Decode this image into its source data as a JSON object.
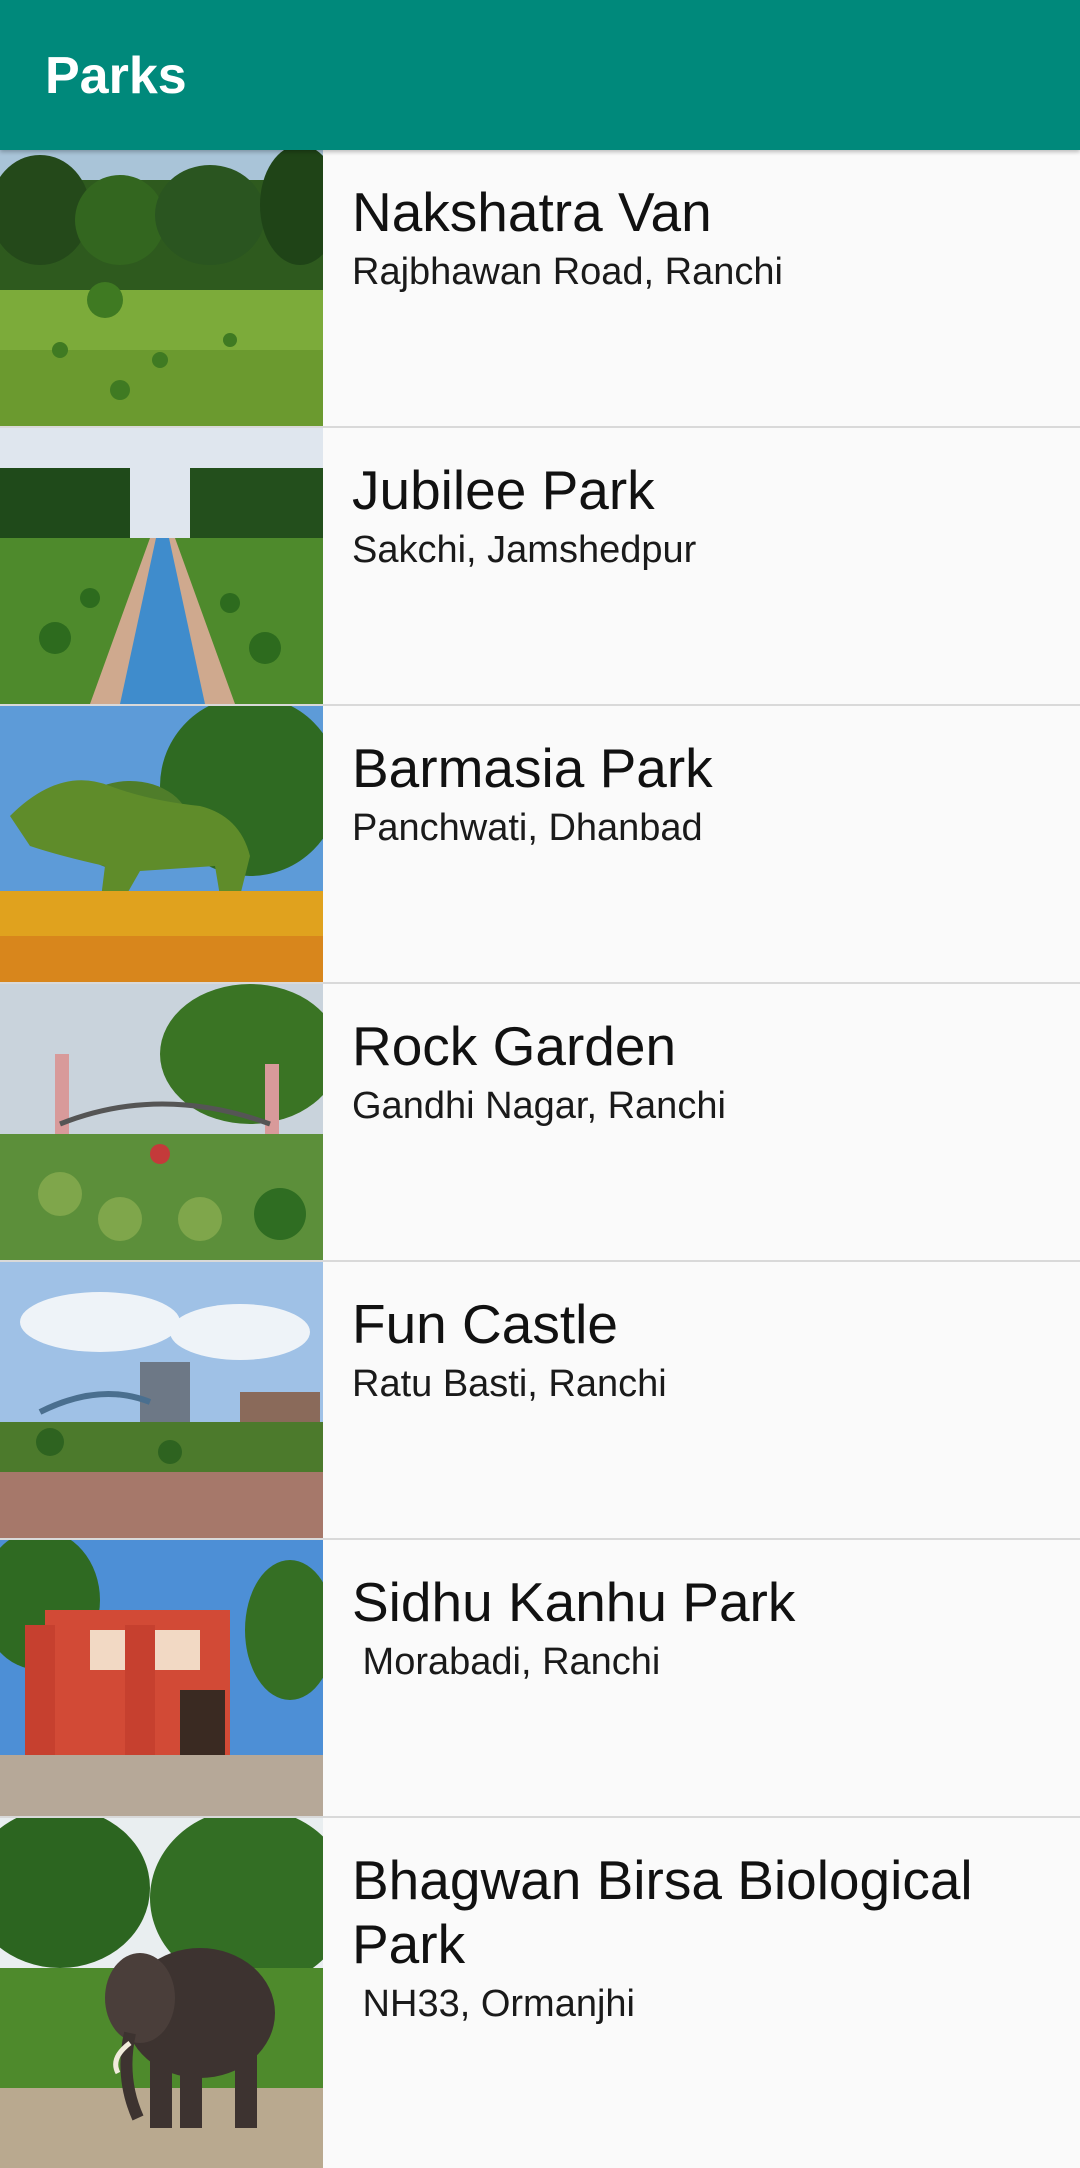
{
  "app_bar": {
    "title": "Parks",
    "color": "#00897b"
  },
  "parks": [
    {
      "name": "Nakshatra Van",
      "location": "Rajbhawan Road, Ranchi"
    },
    {
      "name": "Jubilee Park",
      "location": "Sakchi, Jamshedpur"
    },
    {
      "name": "Barmasia Park",
      "location": "Panchwati, Dhanbad"
    },
    {
      "name": "Rock Garden",
      "location": "Gandhi Nagar, Ranchi"
    },
    {
      "name": "Fun Castle",
      "location": "Ratu Basti, Ranchi"
    },
    {
      "name": "Sidhu Kanhu Park",
      "location": " Morabadi, Ranchi"
    },
    {
      "name": "Bhagwan Birsa Biological Park",
      "location": " NH33, Ormanjhi"
    }
  ]
}
